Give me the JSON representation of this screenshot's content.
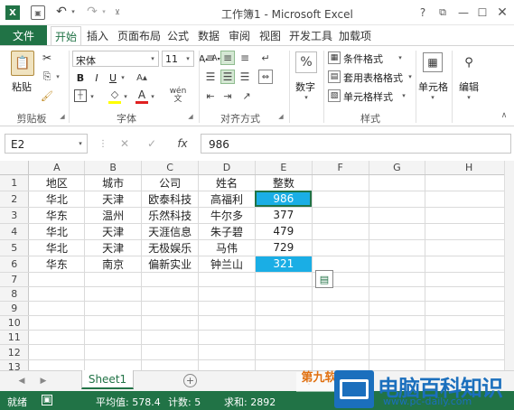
{
  "window": {
    "title": "工作簿1 - Microsoft Excel"
  },
  "tabs": {
    "file": "文件",
    "home": "开始",
    "insert": "插入",
    "layout": "页面布局",
    "formulas": "公式",
    "data": "数据",
    "review": "审阅",
    "view": "视图",
    "developer": "开发工具",
    "addins": "加载项"
  },
  "ribbon": {
    "paste": "粘贴",
    "clipboard": "剪贴板",
    "font_name": "宋体",
    "font_size": "11",
    "font_group": "字体",
    "align_group": "对齐方式",
    "number": "数字",
    "percent": "%",
    "cond_format": "条件格式",
    "table_format": "套用表格格式",
    "cell_style": "单元格样式",
    "styles_group": "样式",
    "cells": "单元格",
    "editing": "编辑",
    "wen": "wén"
  },
  "formula_bar": {
    "name_box": "E2",
    "fx": "fx",
    "value": "986"
  },
  "columns": [
    "A",
    "B",
    "C",
    "D",
    "E",
    "F",
    "G",
    "H"
  ],
  "rows": [
    [
      "地区",
      "城市",
      "公司",
      "姓名",
      "整数",
      "",
      "",
      ""
    ],
    [
      "华北",
      "天津",
      "欧泰科技",
      "高福利",
      "986",
      "",
      "",
      ""
    ],
    [
      "华东",
      "温州",
      "乐然科技",
      "牛尔多",
      "377",
      "",
      "",
      ""
    ],
    [
      "华北",
      "天津",
      "天涯信息",
      "朱子碧",
      "479",
      "",
      "",
      ""
    ],
    [
      "华北",
      "天津",
      "无极娱乐",
      "马伟",
      "729",
      "",
      "",
      ""
    ],
    [
      "华东",
      "南京",
      "偏新实业",
      "钟兰山",
      "321",
      "",
      "",
      ""
    ],
    [
      "",
      "",
      "",
      "",
      "",
      "",
      "",
      ""
    ],
    [
      "",
      "",
      "",
      "",
      "",
      "",
      "",
      ""
    ],
    [
      "",
      "",
      "",
      "",
      "",
      "",
      "",
      ""
    ],
    [
      "",
      "",
      "",
      "",
      "",
      "",
      "",
      ""
    ],
    [
      "",
      "",
      "",
      "",
      "",
      "",
      "",
      ""
    ],
    [
      "",
      "",
      "",
      "",
      "",
      "",
      "",
      ""
    ],
    [
      "",
      "",
      "",
      "",
      "",
      "",
      "",
      ""
    ]
  ],
  "row_numbers": [
    "1",
    "2",
    "3",
    "4",
    "5",
    "6",
    "7",
    "8",
    "9",
    "10",
    "11",
    "12",
    "13"
  ],
  "sheet": {
    "name": "Sheet1"
  },
  "status": {
    "ready": "就绪",
    "average": "平均值: 578.4",
    "count": "计数: 5",
    "sum": "求和: 2892"
  },
  "watermark": {
    "left": "第九软件网",
    "right": "电脑百科知识",
    "url": "www.pc-daily.com"
  },
  "colors": {
    "excel_green": "#217346",
    "highlight": "#1aaee5"
  }
}
